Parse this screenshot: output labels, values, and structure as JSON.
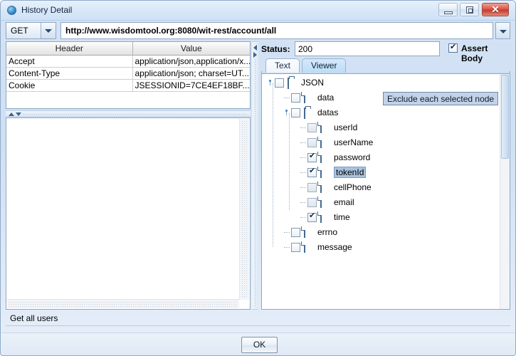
{
  "window": {
    "title": "History Detail",
    "icon": "app-circle-icon",
    "buttons": {
      "minimize": "minimize-icon",
      "maximize": "maximize-icon",
      "close": "✕"
    }
  },
  "request": {
    "method": "GET",
    "url": "http://www.wisdomtool.org:8080/wit-rest/account/all"
  },
  "headers_table": {
    "columns": [
      "Header",
      "Value"
    ],
    "rows": [
      [
        "Accept",
        "application/json,application/x..."
      ],
      [
        "Content-Type",
        "application/json; charset=UT..."
      ],
      [
        "Cookie",
        "JSESSIONID=7CE4EF18BF..."
      ]
    ]
  },
  "response": {
    "status_label": "Status:",
    "status_value": "200",
    "assert_body_label": "Assert Body",
    "assert_body_checked": true,
    "tabs": [
      {
        "label": "Text",
        "selected": false
      },
      {
        "label": "Viewer",
        "selected": true
      }
    ]
  },
  "tooltip": {
    "text": "Exclude each selected node"
  },
  "tree": {
    "nodes": [
      {
        "label": "JSON",
        "depth": 0,
        "icon": "folder-icon",
        "checked": false,
        "dim": false,
        "selected": false,
        "expander": true
      },
      {
        "label": "data",
        "depth": 1,
        "icon": "file-icon",
        "checked": false,
        "dim": false,
        "selected": false,
        "expander": false
      },
      {
        "label": "datas",
        "depth": 1,
        "icon": "folder-icon",
        "checked": false,
        "dim": false,
        "selected": false,
        "expander": true
      },
      {
        "label": "userId",
        "depth": 2,
        "icon": "file-icon",
        "checked": false,
        "dim": true,
        "selected": false,
        "expander": false
      },
      {
        "label": "userName",
        "depth": 2,
        "icon": "file-icon",
        "checked": false,
        "dim": true,
        "selected": false,
        "expander": false
      },
      {
        "label": "password",
        "depth": 2,
        "icon": "file-icon",
        "checked": true,
        "dim": false,
        "selected": false,
        "expander": false
      },
      {
        "label": "tokenId",
        "depth": 2,
        "icon": "file-icon",
        "checked": true,
        "dim": false,
        "selected": true,
        "expander": false
      },
      {
        "label": "cellPhone",
        "depth": 2,
        "icon": "file-icon",
        "checked": false,
        "dim": true,
        "selected": false,
        "expander": false
      },
      {
        "label": "email",
        "depth": 2,
        "icon": "file-icon",
        "checked": false,
        "dim": true,
        "selected": false,
        "expander": false
      },
      {
        "label": "time",
        "depth": 2,
        "icon": "file-icon",
        "checked": true,
        "dim": false,
        "selected": false,
        "expander": false
      },
      {
        "label": "errno",
        "depth": 1,
        "icon": "file-icon",
        "checked": false,
        "dim": false,
        "selected": false,
        "expander": false
      },
      {
        "label": "message",
        "depth": 1,
        "icon": "file-icon",
        "checked": false,
        "dim": false,
        "selected": false,
        "expander": false
      }
    ]
  },
  "description": {
    "text": "Get all users"
  },
  "footer": {
    "ok_label": "OK"
  },
  "colors": {
    "window_chrome": "#cfe0f3",
    "accent_selection": "#a8c2de",
    "close_button": "#c23c2d",
    "tab_selected": "#bcdcf6",
    "tooltip_bg": "#c3d2e6"
  }
}
